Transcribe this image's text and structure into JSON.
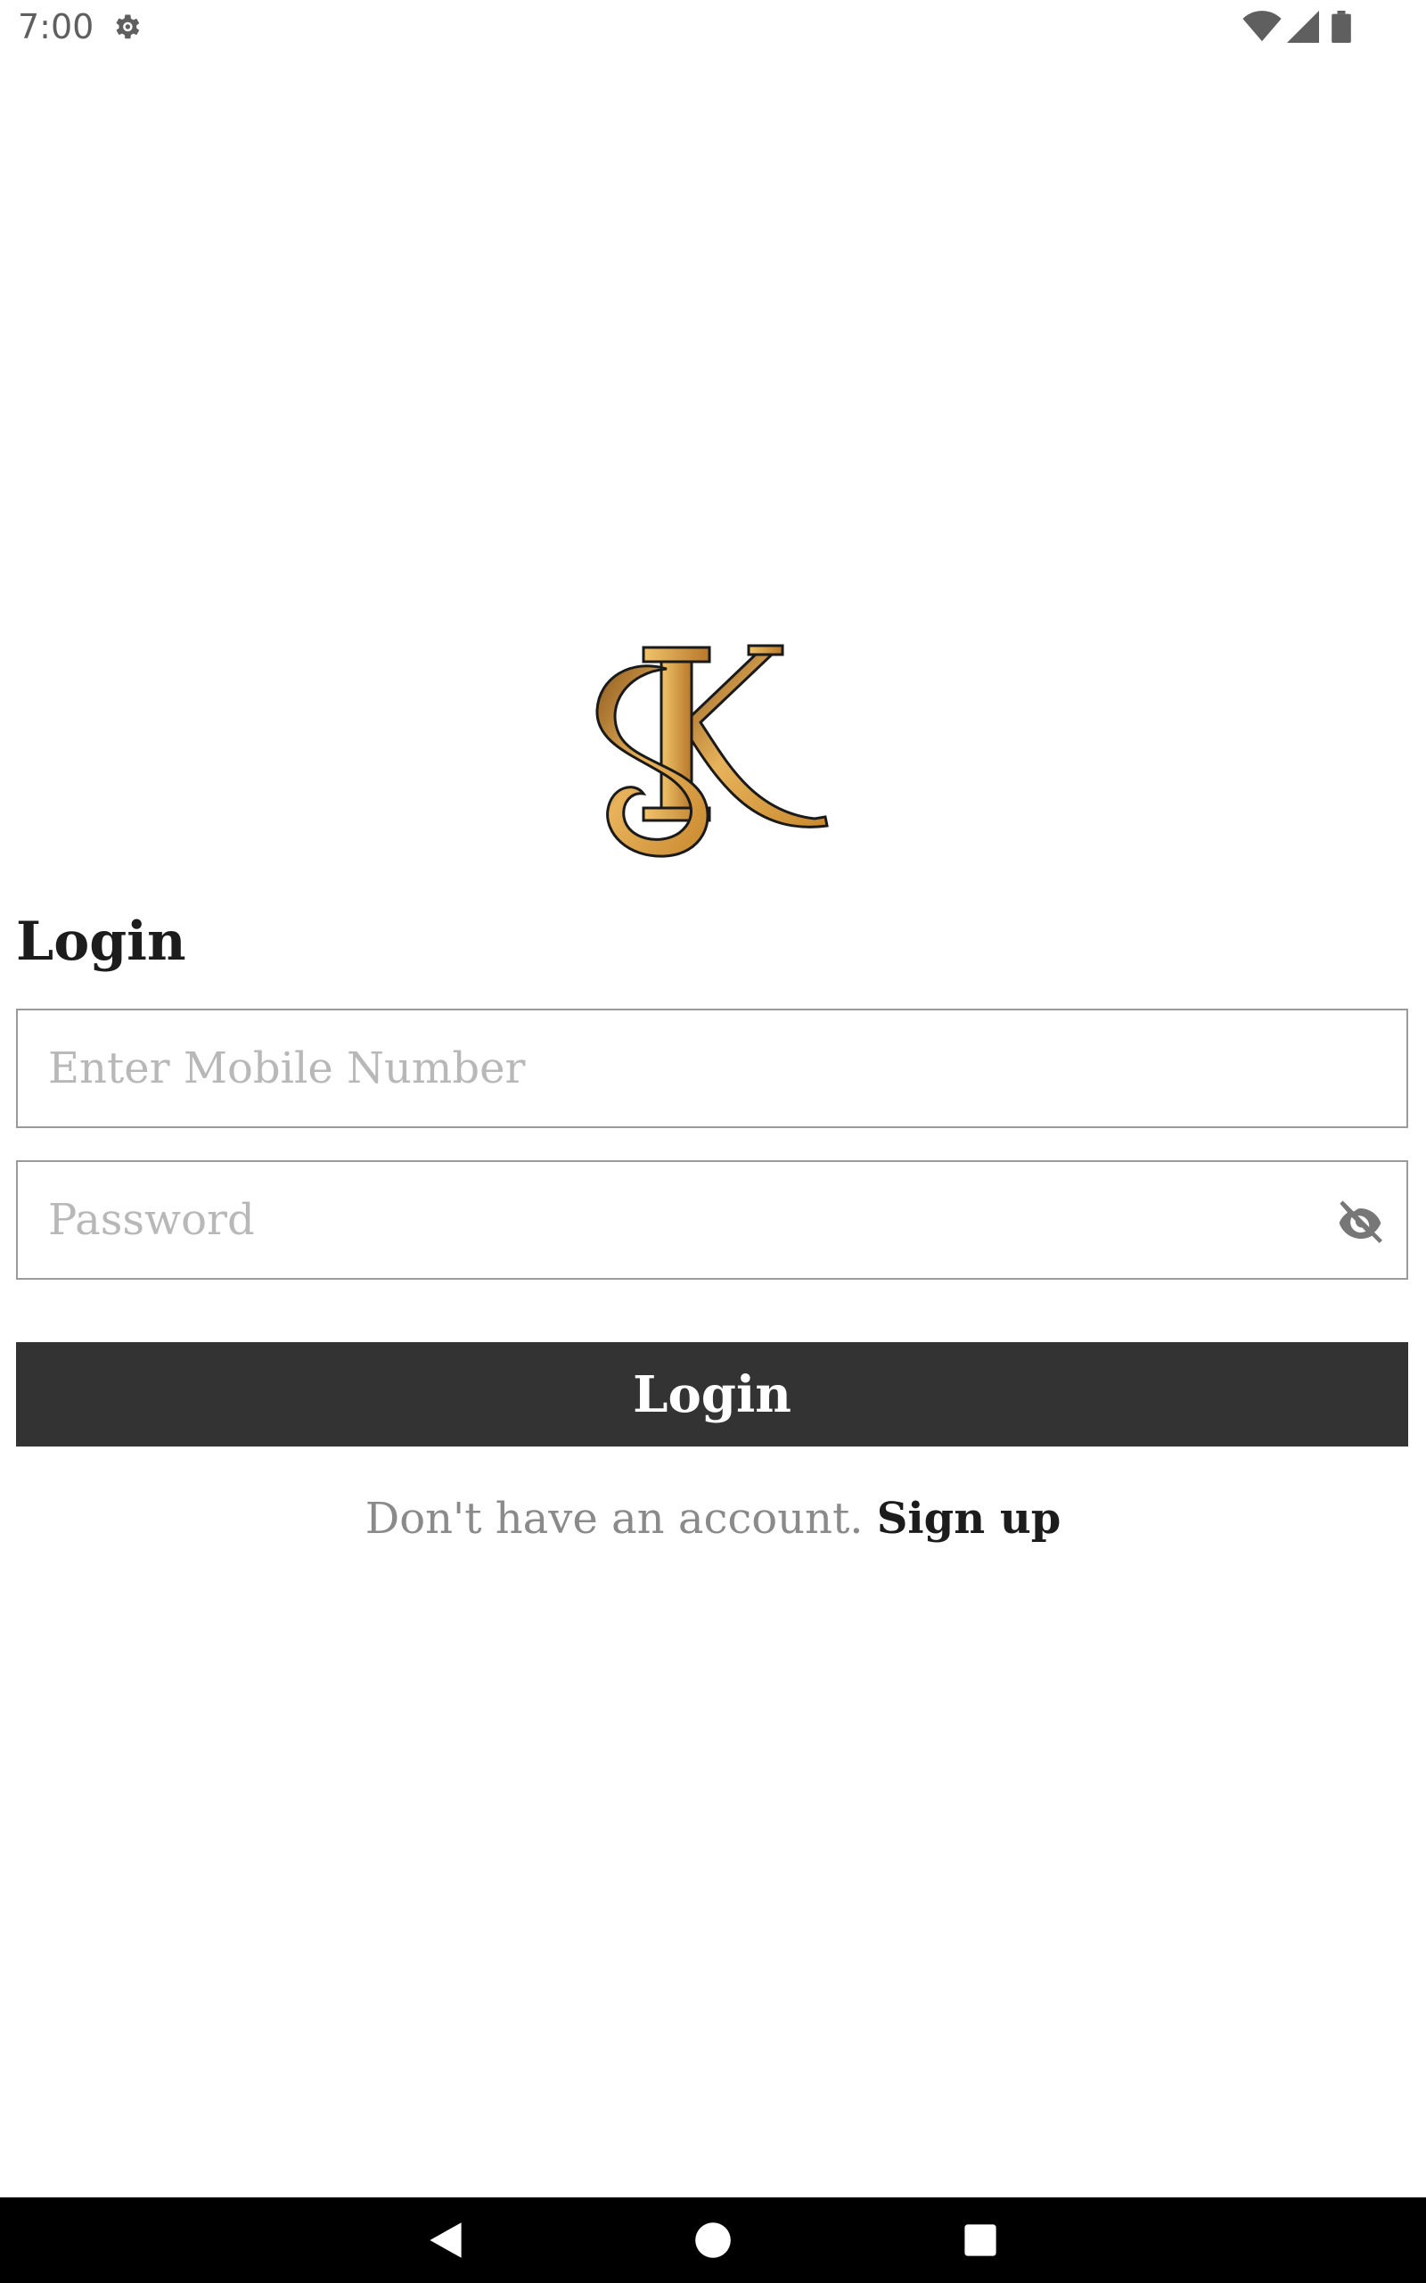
{
  "status_bar": {
    "time": "7:00",
    "icons": [
      "settings-gear-icon",
      "wifi-icon",
      "cellular-signal-icon",
      "battery-icon"
    ]
  },
  "brand": {
    "logo_icon": "sk-monogram-logo",
    "accent_color": "#C9892E"
  },
  "login_form": {
    "title": "Login",
    "mobile_placeholder": "Enter Mobile Number",
    "mobile_value": "",
    "password_placeholder": "Password",
    "password_value": "",
    "visibility_icon": "eye-off-icon",
    "submit_label": "Login",
    "button_color": "#333333"
  },
  "signup": {
    "prompt": "Don't have an account.",
    "link_label": "Sign up"
  },
  "nav_bar": {
    "icons": [
      "back-triangle-icon",
      "home-circle-icon",
      "recents-square-icon"
    ]
  }
}
